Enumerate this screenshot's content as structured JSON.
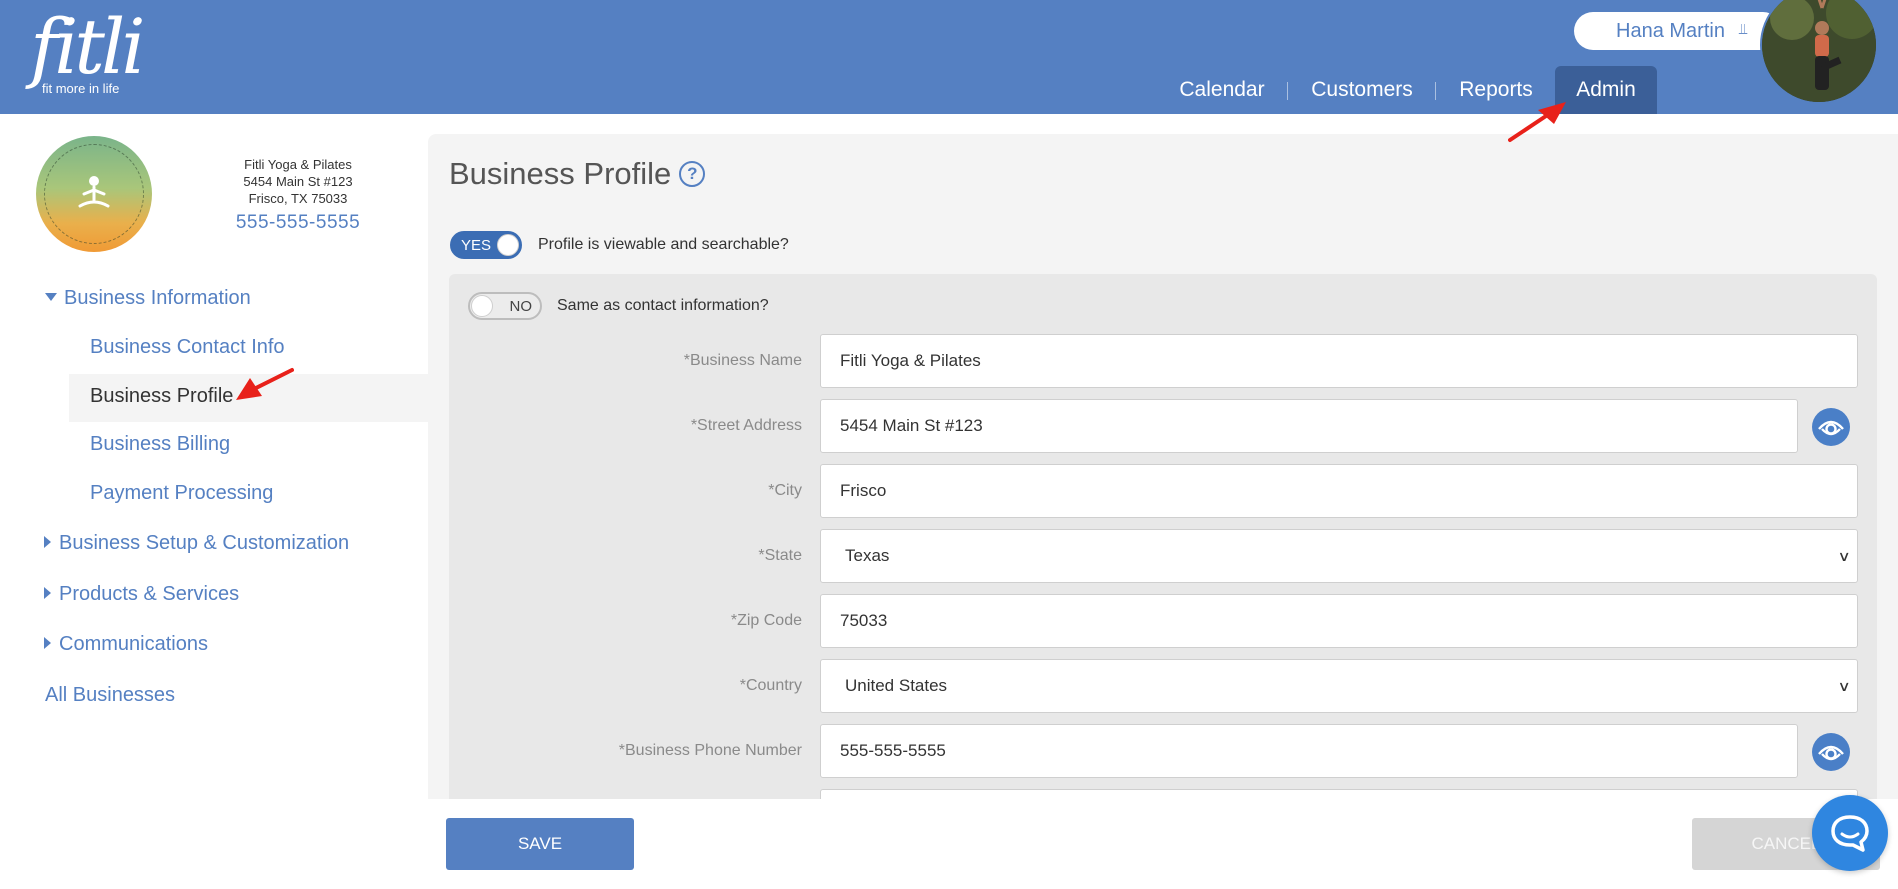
{
  "header": {
    "logo_text": "fitli",
    "logo_tagline": "fit more in life",
    "user_name": "Hana Martin",
    "nav": [
      "Calendar",
      "Customers",
      "Reports",
      "Admin"
    ],
    "active_nav": "Admin"
  },
  "business": {
    "name": "Fitli Yoga & Pilates",
    "address1": "5454 Main St #123",
    "address2": "Frisco, TX 75033",
    "phone": "555-555-5555"
  },
  "sidebar": {
    "sections": [
      {
        "label": "Business Information",
        "expanded": true
      },
      {
        "label": "Business Setup & Customization",
        "expanded": false
      },
      {
        "label": "Products & Services",
        "expanded": false
      },
      {
        "label": "Communications",
        "expanded": false
      }
    ],
    "sub_items": [
      "Business Contact Info",
      "Business Profile",
      "Business Billing",
      "Payment Processing"
    ],
    "active_item": "Business Profile",
    "all_businesses": "All Businesses"
  },
  "page": {
    "title": "Business Profile",
    "help_icon": "?",
    "profile_toggle": {
      "state": "YES",
      "label": "Profile is viewable and searchable?"
    },
    "contact_toggle": {
      "state": "NO",
      "label": "Same as contact information?"
    }
  },
  "form": {
    "fields": [
      {
        "label": "*Business Name",
        "value": "Fitli Yoga & Pilates"
      },
      {
        "label": "*Street Address",
        "value": "5454 Main St #123"
      },
      {
        "label": "*City",
        "value": "Frisco"
      },
      {
        "label": "*State",
        "value": "Texas"
      },
      {
        "label": "*Zip Code",
        "value": "75033"
      },
      {
        "label": "*Country",
        "value": "United States"
      },
      {
        "label": "*Business Phone Number",
        "value": "555-555-5555"
      }
    ]
  },
  "buttons": {
    "save": "SAVE",
    "cancel": "CANCEL"
  },
  "colors": {
    "header": "#5580c2",
    "accent": "#3b6db4",
    "link": "#5580c2",
    "annotation_arrow": "#e8211a"
  },
  "icons": [
    "chevron-down-double-icon",
    "help-icon",
    "eye-icon",
    "chat-icon",
    "caret-down-icon",
    "caret-right-icon"
  ]
}
